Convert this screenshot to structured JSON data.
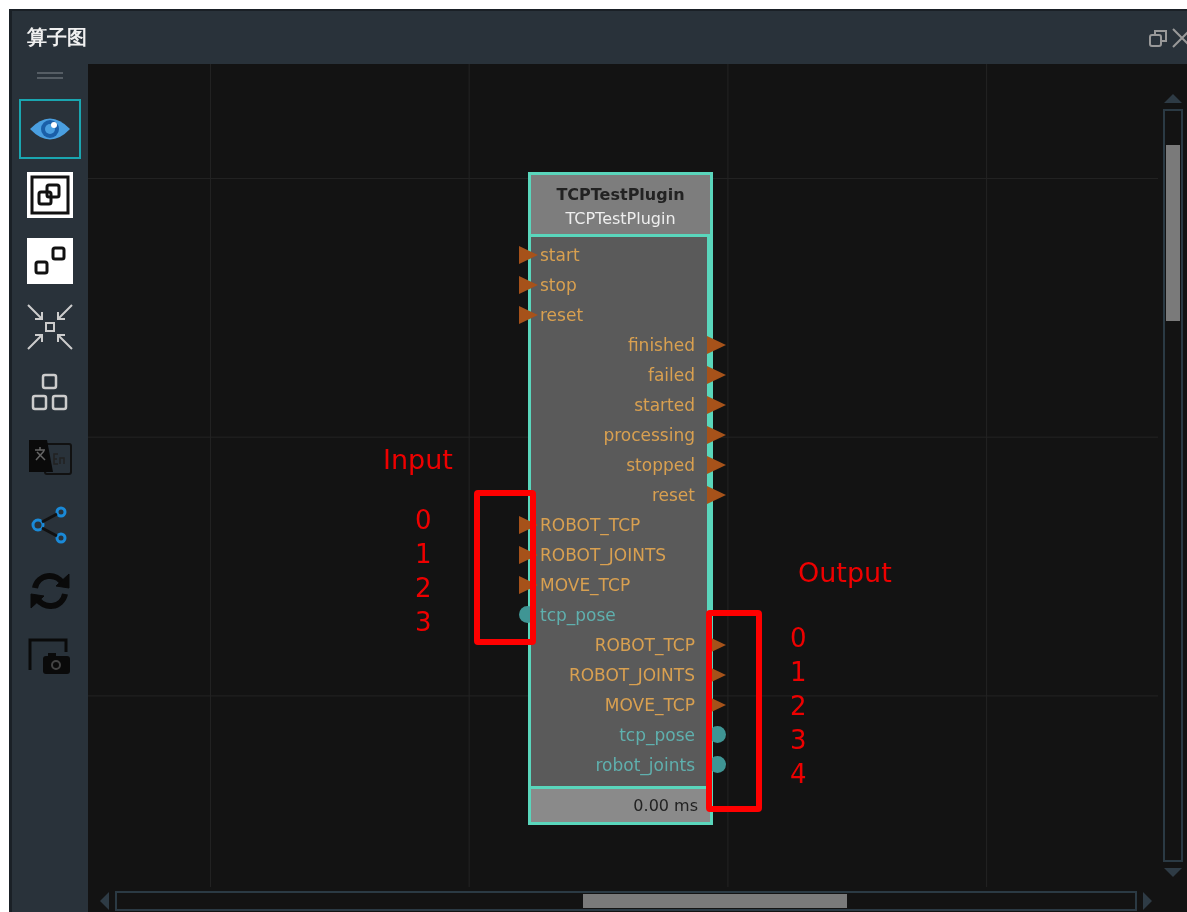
{
  "window": {
    "title": "算子图"
  },
  "toolbar": [
    {
      "kind": "eye",
      "selected": true
    },
    {
      "kind": "link",
      "selected": false
    },
    {
      "kind": "nodes",
      "selected": false
    },
    {
      "kind": "collapse",
      "selected": false
    },
    {
      "kind": "hierarchy",
      "selected": false
    },
    {
      "kind": "translate",
      "selected": false
    },
    {
      "kind": "share",
      "selected": false
    },
    {
      "kind": "refresh",
      "selected": false
    },
    {
      "kind": "screenshot",
      "selected": false
    }
  ],
  "node": {
    "title": "TCPTestPlugin",
    "subtitle": "TCPTestPlugin",
    "ports": [
      {
        "label": "start",
        "kind": "exec",
        "output": false
      },
      {
        "label": "stop",
        "kind": "exec",
        "output": false
      },
      {
        "label": "reset",
        "kind": "exec",
        "output": false
      },
      {
        "label": "finished",
        "kind": "exec",
        "output": true
      },
      {
        "label": "failed",
        "kind": "exec",
        "output": true
      },
      {
        "label": "started",
        "kind": "exec",
        "output": true
      },
      {
        "label": "processing",
        "kind": "exec",
        "output": true
      },
      {
        "label": "stopped",
        "kind": "exec",
        "output": true
      },
      {
        "label": "reset",
        "kind": "exec",
        "output": true
      },
      {
        "label": "ROBOT_TCP",
        "kind": "exec",
        "output": false
      },
      {
        "label": "ROBOT_JOINTS",
        "kind": "exec",
        "output": false
      },
      {
        "label": "MOVE_TCP",
        "kind": "exec",
        "output": false
      },
      {
        "label": "tcp_pose",
        "kind": "data",
        "output": false
      },
      {
        "label": "ROBOT_TCP",
        "kind": "exec",
        "output": true
      },
      {
        "label": "ROBOT_JOINTS",
        "kind": "exec",
        "output": true
      },
      {
        "label": "MOVE_TCP",
        "kind": "exec",
        "output": true
      },
      {
        "label": "tcp_pose",
        "kind": "data",
        "output": true
      },
      {
        "label": "robot_joints",
        "kind": "data",
        "output": true
      }
    ],
    "footer": "0.00 ms"
  },
  "annotations": {
    "input": {
      "label": "Input",
      "indices": [
        "0",
        "1",
        "2",
        "3"
      ]
    },
    "output": {
      "label": "Output",
      "indices": [
        "0",
        "1",
        "2",
        "3",
        "4"
      ]
    }
  }
}
